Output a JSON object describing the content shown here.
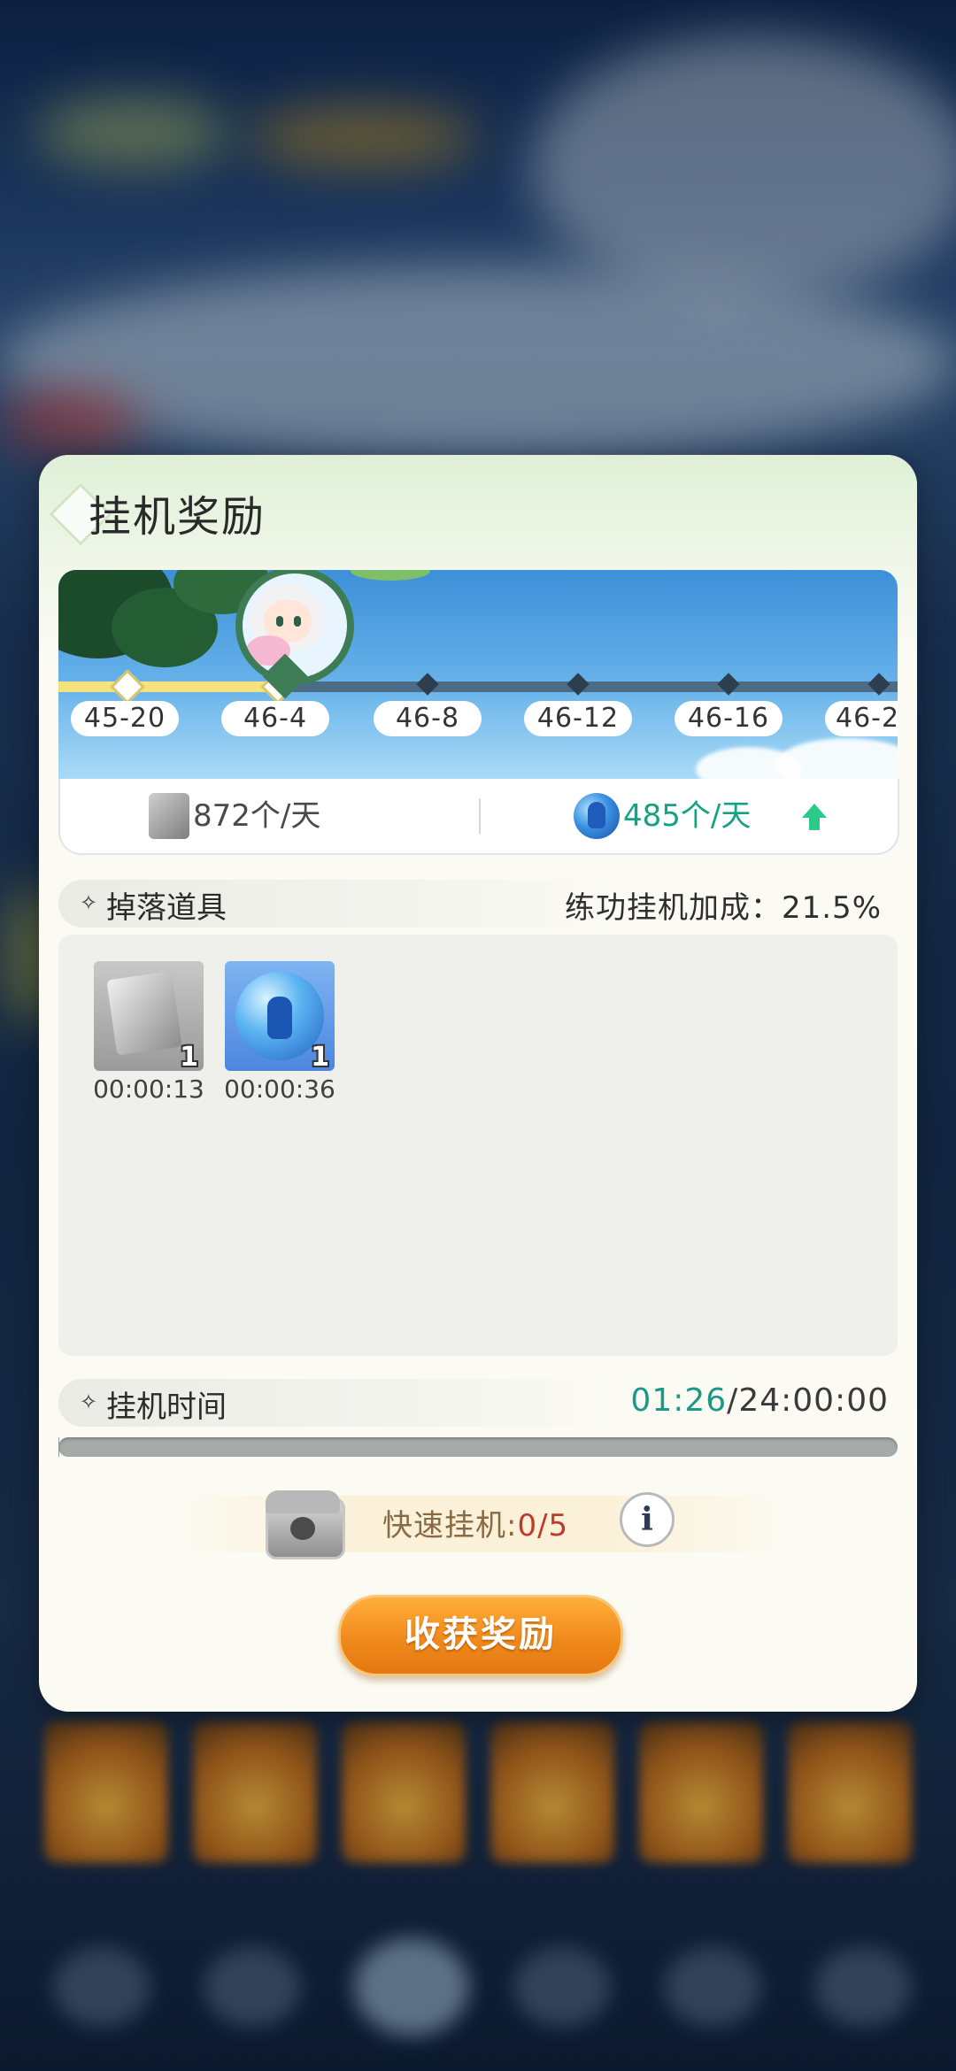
{
  "dialog": {
    "title": "挂机奖励",
    "stages": [
      "45-20",
      "46-4",
      "46-8",
      "46-12",
      "46-16",
      "46-2"
    ],
    "rates": [
      {
        "icon": "skill-book-icon",
        "value": "872个/天",
        "color": "#4a4a4a"
      },
      {
        "icon": "spirit-orb-icon",
        "value": "485个/天",
        "color": "#15a283",
        "trend_icon": "up-arrow-icon"
      }
    ]
  },
  "drops": {
    "title": "掉落道具",
    "bonus_label": "练功挂机加成：",
    "bonus_value": "21.5%",
    "items": [
      {
        "icon": "skill-book-icon",
        "count": "1",
        "time": "00:00:13"
      },
      {
        "icon": "spirit-orb-icon",
        "count": "1",
        "time": "00:00:36"
      }
    ]
  },
  "idle": {
    "title": "挂机时间",
    "elapsed": "01:26",
    "separator": "/",
    "max": "24:00:00",
    "elapsed_color": "#1a9a86",
    "progress_fraction": 0.001
  },
  "quick_idle": {
    "label": "快速挂机:",
    "count": "0/5",
    "count_color": "#c0392b",
    "info_glyph": "i"
  },
  "collect_button": "收获奖励"
}
